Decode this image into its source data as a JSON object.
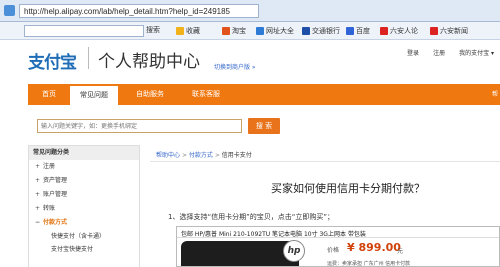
{
  "browser": {
    "url": "http://help.alipay.com/lab/help_detail.htm?help_id=249185",
    "search_label": "搜索",
    "bookmarks": [
      {
        "label": "收藏",
        "color": "#f2b21c"
      },
      {
        "label": "淘宝",
        "color": "#e2531b"
      },
      {
        "label": "网址大全",
        "color": "#2e7bd6"
      },
      {
        "label": "交通银行",
        "color": "#1e4fa8"
      },
      {
        "label": "百度",
        "color": "#2f63d8"
      },
      {
        "label": "六安人论",
        "color": "#d22"
      },
      {
        "label": "六安新闻",
        "color": "#d22"
      }
    ]
  },
  "header": {
    "logo": "支付宝",
    "title": "个人帮助中心",
    "switch_link": "切换到商户版 »",
    "links": [
      "登录",
      "注册",
      "我的支付宝 ▾"
    ]
  },
  "nav": {
    "items": [
      "首页",
      "常见问题",
      "自助服务",
      "联系客服"
    ],
    "active_index": 1,
    "right_text": "帮"
  },
  "search": {
    "placeholder": "输入问题关键字，如：更换手机绑定",
    "button": "搜 索"
  },
  "sidebar": {
    "heading": "常见问题分类",
    "items": [
      {
        "label": "注册",
        "marker": "+",
        "open": false
      },
      {
        "label": "资产管理",
        "marker": "+",
        "open": false
      },
      {
        "label": "账户管理",
        "marker": "+",
        "open": false
      },
      {
        "label": "转账",
        "marker": "+",
        "open": false
      },
      {
        "label": "付款方式",
        "marker": "−",
        "open": true
      }
    ],
    "subitems": [
      "快捷支付（含卡通）",
      "支付宝快捷支付"
    ]
  },
  "breadcrumb": {
    "items": [
      "帮助中心",
      "付款方式",
      "信用卡支付"
    ],
    "separator": ">"
  },
  "article": {
    "title": "买家如何使用信用卡分期付款？",
    "step1": "1、选择支持“信用卡分期”的宝贝，点击“立即购买”；"
  },
  "product": {
    "title": "包邮 HP/惠普 Mini 210-1092TU 笔记本电脑 10寸 3G上网本 带包装",
    "price_label": "价格",
    "price": "¥ 899.00",
    "unit": "元",
    "meta": "运费：卖家承担   广东广州   信用卡付款"
  }
}
